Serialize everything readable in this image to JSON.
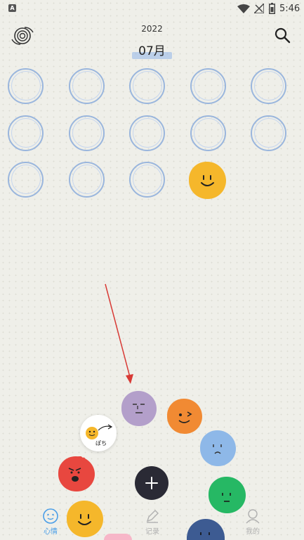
{
  "status_bar": {
    "app_badge": "A",
    "time": "5:46"
  },
  "header": {
    "year": "2022",
    "month": "07月",
    "menu_icon": "spiral-icon",
    "search_icon": "search-icon"
  },
  "calendar": {
    "empty_days": 13,
    "recorded_day_mood": "happy",
    "recorded_day_color": "#f5b72b"
  },
  "mood_picker": {
    "moods": [
      {
        "name": "calm",
        "color": "#b39fca"
      },
      {
        "name": "playful",
        "color": "#f18a33"
      },
      {
        "name": "sad",
        "color": "#8eb8e8"
      },
      {
        "name": "content",
        "color": "#26b864"
      },
      {
        "name": "angry",
        "color": "#e8473f"
      },
      {
        "name": "happy",
        "color": "#f5b72b"
      },
      {
        "name": "tired",
        "color": "#3d5b92"
      }
    ],
    "add_icon": "plus-icon"
  },
  "bottom_nav": {
    "items": [
      {
        "label": "心情",
        "icon": "smile-icon",
        "active": true
      },
      {
        "label": "记录",
        "icon": "pencil-icon",
        "active": false
      },
      {
        "label": "我的",
        "icon": "profile-icon",
        "active": false
      }
    ]
  }
}
